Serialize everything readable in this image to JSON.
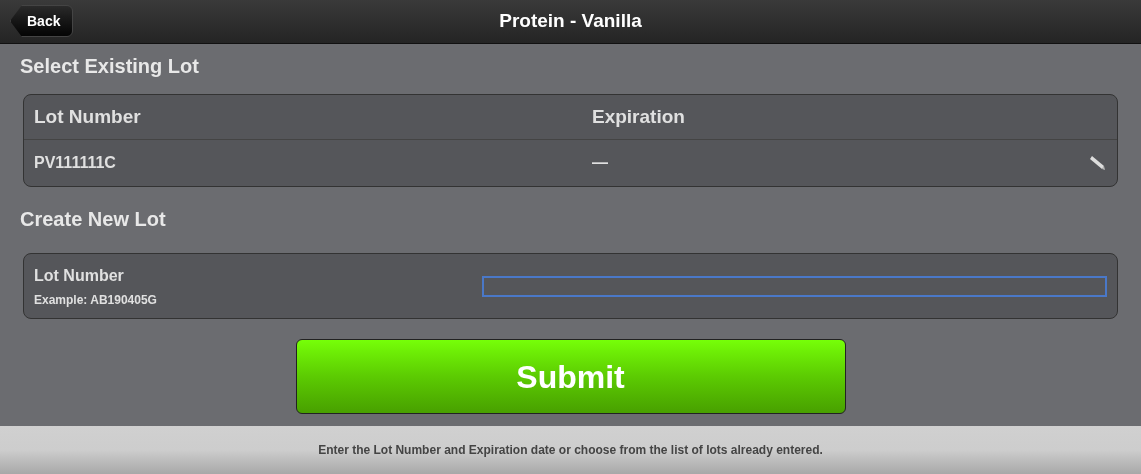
{
  "header": {
    "back": "Back",
    "title": "Protein - Vanilla"
  },
  "existing": {
    "title": "Select Existing Lot",
    "columns": [
      "Lot Number",
      "Expiration"
    ],
    "rows": [
      {
        "lot": "PV111111C",
        "expiration": "—"
      }
    ]
  },
  "create": {
    "title": "Create New Lot",
    "label": "Lot Number",
    "hint": "Example: AB190405G",
    "focused": true
  },
  "submit": "Submit",
  "footer": "Enter the Lot Number and Expiration date or choose from the list of lots already entered."
}
